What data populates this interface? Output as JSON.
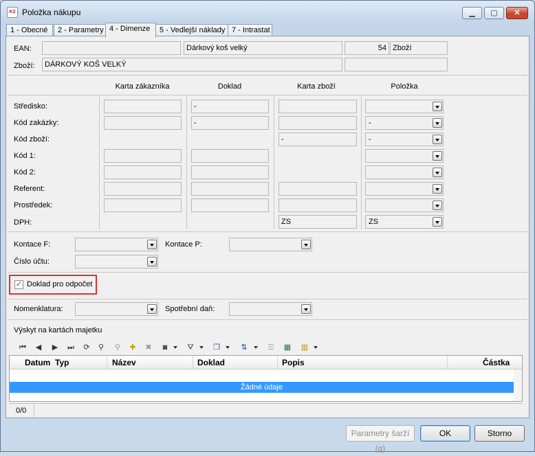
{
  "window": {
    "title": "Položka nákupu"
  },
  "tabs": [
    "1 - Obecné",
    "2 - Parametry",
    "4 - Dimenze",
    "5 - Vedlejší náklady",
    "7 - Intrastat"
  ],
  "top": {
    "ean_label": "EAN:",
    "ean_value": "",
    "name_short": "Dárkový koš velký",
    "number": "54",
    "type": "Zboží",
    "zbozi_label": "Zboží:",
    "zbozi_value": "DÁRKOVÝ KOŠ VELKÝ",
    "extra": ""
  },
  "dimensions": {
    "columns": [
      "Karta zákazníka",
      "Doklad",
      "Karta zboží",
      "Položka"
    ],
    "rows": [
      {
        "label": "Středisko:",
        "karta_zakaznika": "",
        "doklad": "-",
        "karta_zbozi": "",
        "polozka": ""
      },
      {
        "label": "Kód zakázky:",
        "karta_zakaznika": "",
        "doklad": "-",
        "karta_zbozi": "",
        "polozka": "-"
      },
      {
        "label": "Kód zboží:",
        "karta_zbozi": "-",
        "polozka": "-"
      },
      {
        "label": "Kód 1:",
        "karta_zakaznika": "",
        "doklad": "",
        "polozka": ""
      },
      {
        "label": "Kód 2:",
        "karta_zakaznika": "",
        "doklad": "",
        "polozka": ""
      },
      {
        "label": "Referent:",
        "karta_zakaznika": "",
        "doklad": "",
        "karta_zbozi": "",
        "polozka": ""
      },
      {
        "label": "Prostředek:",
        "karta_zakaznika": "",
        "doklad": "",
        "karta_zbozi": "",
        "polozka": ""
      },
      {
        "label": "DPH:",
        "karta_zbozi": "ZS",
        "polozka": "ZS"
      }
    ]
  },
  "kontace": {
    "kontace_f_label": "Kontace F:",
    "kontace_f_value": "",
    "kontace_p_label": "Kontace P:",
    "kontace_p_value": "",
    "cislo_uctu_label": "Číslo účtu:",
    "cislo_uctu_value": ""
  },
  "checkbox": {
    "label": "Doklad pro odpočet",
    "checked": true,
    "mark": "✓"
  },
  "nomen": {
    "nomenklatura_label": "Nomenklatura:",
    "nomenklatura_value": "",
    "spotrebni_label": "Spotřební daň:",
    "spotrebni_value": ""
  },
  "majetek": {
    "title": "Výskyt na kartách majetku",
    "toolbar_icons": [
      "first-icon",
      "prev-icon",
      "next-icon",
      "last-icon",
      "refresh-icon",
      "binoculars-icon",
      "find-icon",
      "add-icon",
      "delete-icon",
      "camera-icon",
      "filter-icon",
      "copy-icon",
      "sort-icon",
      "list-icon",
      "excel-icon",
      "columns-icon"
    ],
    "columns": [
      "Datum",
      "Typ",
      "Název",
      "Doklad",
      "Popis",
      "Částka"
    ],
    "empty_text": "Žádné údaje",
    "record_count": "0/0"
  },
  "buttons": {
    "batch_params": "Parametry šarží (q)",
    "ok": "OK",
    "cancel": "Storno"
  }
}
